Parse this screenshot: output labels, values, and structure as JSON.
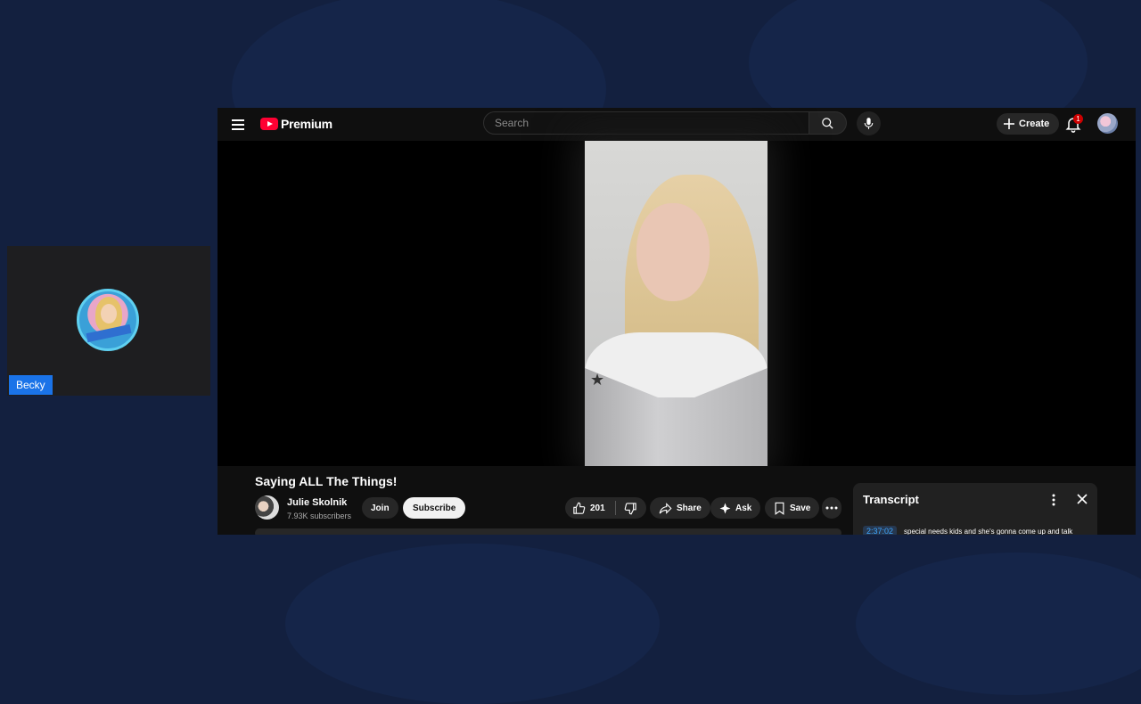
{
  "participant": {
    "name": "Becky"
  },
  "youtube": {
    "logo_text": "Premium",
    "search": {
      "placeholder": "Search"
    },
    "create_label": "Create",
    "notifications_count": "1",
    "video": {
      "title": "Saying ALL The Things!",
      "channel_name": "Julie Skolnik",
      "subscribers": "7.93K subscribers",
      "join_label": "Join",
      "subscribe_label": "Subscribe",
      "like_count": "201",
      "share_label": "Share",
      "ask_label": "Ask",
      "save_label": "Save"
    },
    "transcript": {
      "title": "Transcript",
      "entries": [
        {
          "time": "2:37:02",
          "text": "special needs kids and she's gonna come up and talk"
        }
      ]
    }
  },
  "colors": {
    "page_background": "#13203f",
    "yt_background": "#0f0f0f",
    "accent_red": "#ff0033",
    "name_tag_blue": "#1a73e8",
    "link_blue": "#3ea6ff"
  },
  "icons": [
    "menu-icon",
    "youtube-logo-icon",
    "search-icon",
    "mic-icon",
    "plus-icon",
    "bell-icon",
    "thumbs-up-icon",
    "thumbs-down-icon",
    "share-icon",
    "sparkle-icon",
    "bookmark-icon",
    "more-horizontal-icon",
    "more-vertical-icon",
    "close-icon"
  ]
}
